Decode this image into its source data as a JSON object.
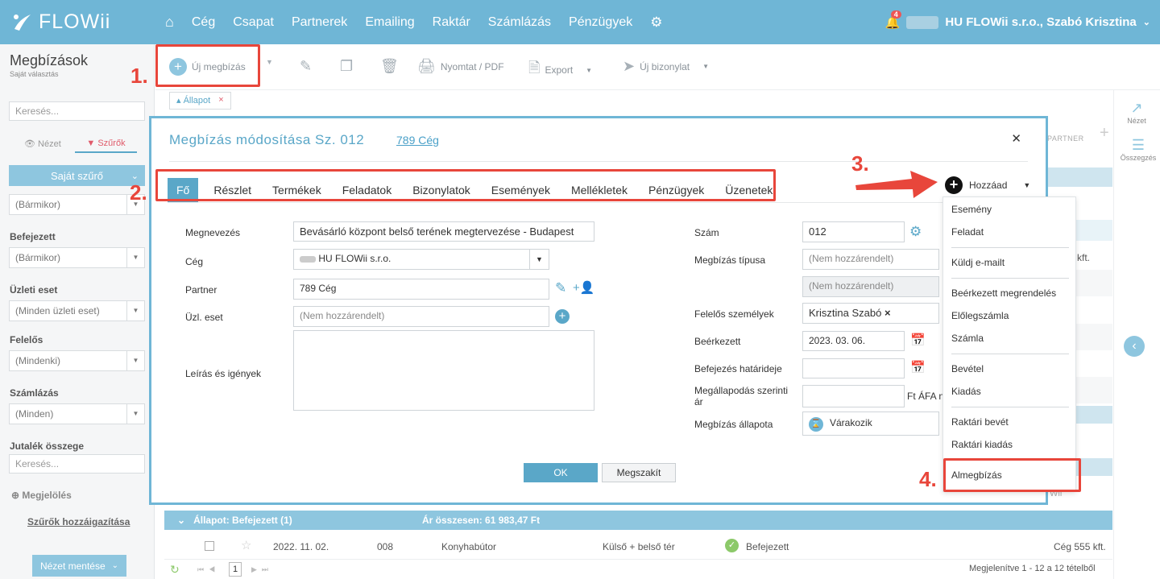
{
  "app": {
    "logo": "FLOWii"
  },
  "nav": {
    "items": [
      "Cég",
      "Csapat",
      "Partnerek",
      "Emailing",
      "Raktár",
      "Számlázás",
      "Pénzügyek"
    ]
  },
  "user": {
    "notification_count": "4",
    "name": "HU FLOWii s.r.o., Szabó Krisztina"
  },
  "left_panel": {
    "title": "Megbízások",
    "subtitle": "Saját választás",
    "search_placeholder": "Keresés...",
    "view_tab": "Nézet",
    "filters_tab": "Szűrők",
    "own_filter": "Saját szűrő",
    "filters": [
      {
        "label": "",
        "value": "(Bármikor)"
      },
      {
        "label": "Befejezett",
        "value": "(Bármikor)"
      },
      {
        "label": "Üzleti eset",
        "value": "(Minden üzleti eset)"
      },
      {
        "label": "Felelős",
        "value": "(Mindenki)"
      },
      {
        "label": "Számlázás",
        "value": "(Minden)"
      }
    ],
    "commission_label": "Jutalék összege",
    "commission_placeholder": "Keresés...",
    "marking": "Megjelölés",
    "assign_filters": "Szűrők hozzáigazítása",
    "save_view": "Nézet mentése"
  },
  "toolbar": {
    "new": "Új megbízás",
    "print": "Nyomtat / PDF",
    "export": "Export",
    "new_doc": "Új bizonylat",
    "filter_chip": "Állapot"
  },
  "right_rail": {
    "view": "Nézet",
    "summary": "Összegzés"
  },
  "background": {
    "col_partner": "PARTNER",
    "partial_kft": "kft.",
    "partial_ii": "Wii",
    "group_header": "Állapot: Befejezett (1)",
    "group_total": "Ár összesen: 61 983,47 Ft",
    "row": {
      "date": "2022. 11. 02.",
      "num": "008",
      "name": "Konyhabútor",
      "type": "Külső + belső tér",
      "status": "Befejezett",
      "partner": "Cég 555 kft."
    },
    "page": "1",
    "pager_info": "Megjelenítve 1 - 12 a 12 tételből"
  },
  "modal": {
    "title": "Megbízás módosítása Sz. 012",
    "company_link": "789 Cég",
    "tabs": [
      "Fő",
      "Részlet",
      "Termékek",
      "Feladatok",
      "Bizonylatok",
      "Események",
      "Mellékletek",
      "Pénzügyek",
      "Üzenetek"
    ],
    "add": "Hozzáad",
    "left_fields": {
      "name_label": "Megnevezés",
      "name_value": "Bevásárló központ belső terének megtervezése - Budapest",
      "company_label": "Cég",
      "company_value": "HU FLOWii s.r.o.",
      "partner_label": "Partner",
      "partner_value": "789 Cég",
      "case_label": "Üzl. eset",
      "case_placeholder": "(Nem hozzárendelt)",
      "desc_label": "Leírás és igények"
    },
    "right_fields": {
      "number_label": "Szám",
      "number_value": "012",
      "type_label": "Megbízás típusa",
      "type_placeholder": "(Nem hozzárendelt)",
      "type_placeholder2": "(Nem hozzárendelt)",
      "responsible_label": "Felelős személyek",
      "responsible_value": "Krisztina Szabó",
      "received_label": "Beérkezett",
      "received_value": "2023. 03. 06.",
      "deadline_label": "Befejezés határideje",
      "price_label": "Megállapodás szerinti ár",
      "price_unit": "Ft ÁFA n",
      "status_label": "Megbízás állapota",
      "status_value": "Várakozik"
    },
    "ok": "OK",
    "cancel": "Megszakít"
  },
  "dropdown": {
    "items": [
      "Esemény",
      "Feladat",
      "Küldj e-mailt",
      "Beérkezett megrendelés",
      "Előlegszámla",
      "Számla",
      "Bevétel",
      "Kiadás",
      "Raktári bevét",
      "Raktári kiadás",
      "Almegbízás"
    ]
  },
  "annotations": [
    "1.",
    "2.",
    "3.",
    "4."
  ],
  "colors": {
    "brand": "#6fb6d6",
    "accent": "#5aa7c8",
    "annotation": "#e8463b",
    "ok_button": "#5aa7c8"
  }
}
